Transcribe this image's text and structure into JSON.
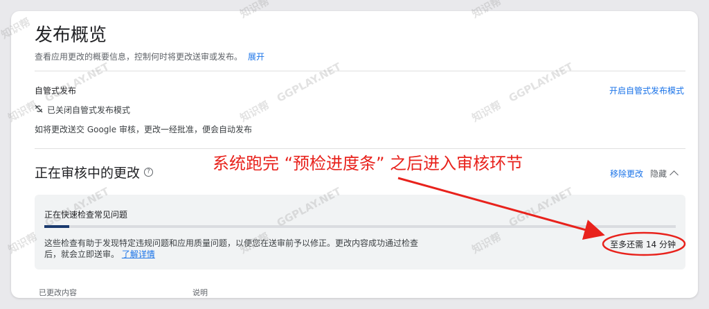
{
  "header": {
    "title": "发布概览",
    "subtitle": "查看应用更改的概要信息，控制何时将更改送审或发布。",
    "expand_label": "展开"
  },
  "managed_publishing": {
    "title": "自管式发布",
    "status": "已关闭自管式发布模式",
    "description": "如将更改送交 Google 审核，更改一经批准，便会自动发布",
    "enable_label": "开启自管式发布模式"
  },
  "in_review": {
    "title": "正在审核中的更改",
    "remove_label": "移除更改",
    "hide_label": "隐藏",
    "check": {
      "title": "正在快速检查常见问题",
      "progress": 0.04,
      "description": "这些检查有助于发现特定违规问题和应用质量问题，以便您在送审前予以修正。更改内容成功通过检查后，就会立即送审。",
      "learn_more_label": "了解详情",
      "time_left": "至多还需 14 分钟"
    },
    "columns": [
      "已更改内容",
      "说明"
    ]
  },
  "annotation": {
    "text": "系统跑完 “预检进度条” 之后进入审核环节",
    "color": "#e8221c"
  },
  "watermark": {
    "text_a": "知识帮",
    "text_b": "GGPLAY.NET"
  },
  "colors": {
    "link": "#1a73e8",
    "progress_fill": "#1a3a6e"
  }
}
